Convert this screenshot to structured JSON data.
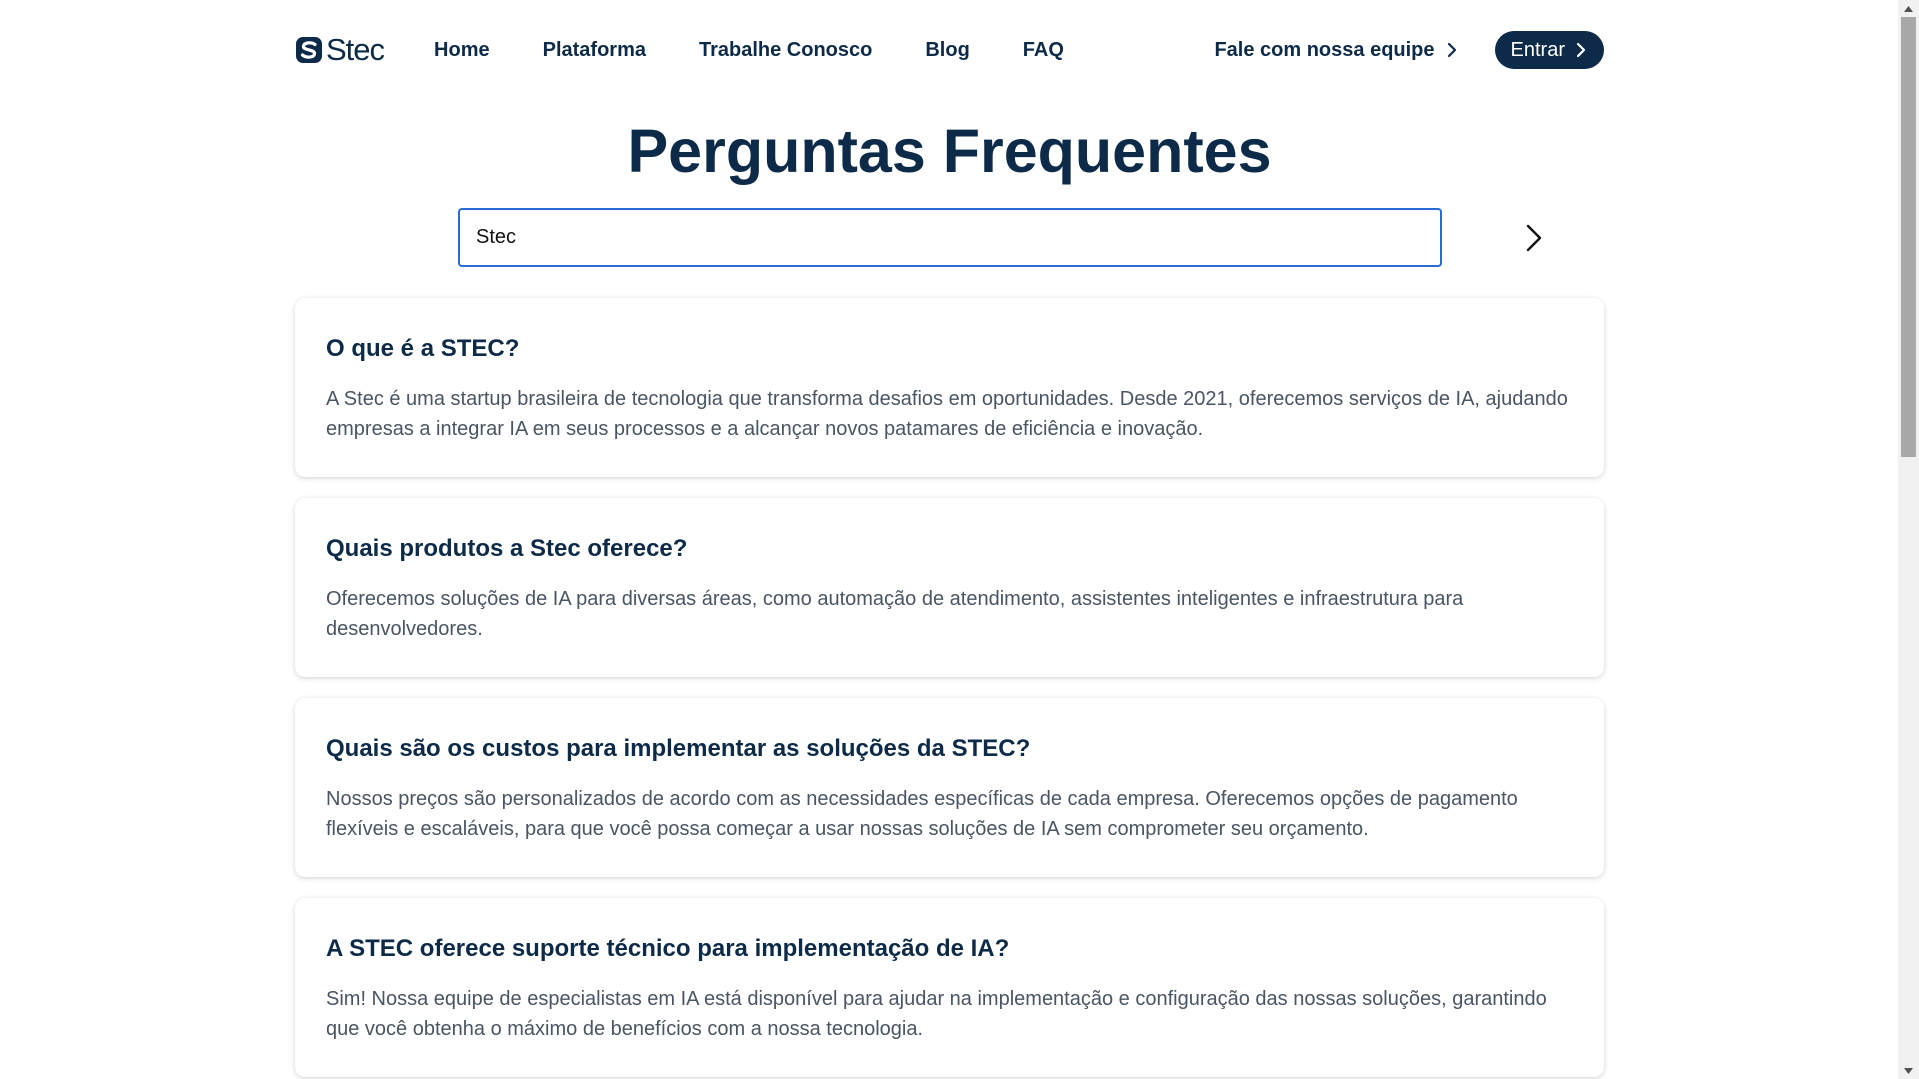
{
  "brand": {
    "name": "Stec"
  },
  "nav": {
    "links": [
      {
        "label": "Home"
      },
      {
        "label": "Plataforma"
      },
      {
        "label": "Trabalhe Conosco"
      },
      {
        "label": "Blog"
      },
      {
        "label": "FAQ"
      }
    ],
    "contact_label": "Fale com nossa equipe",
    "login_label": "Entrar"
  },
  "page": {
    "title": "Perguntas Frequentes"
  },
  "search": {
    "value": "Stec",
    "placeholder": ""
  },
  "faq": {
    "items": [
      {
        "question": "O que é a STEC?",
        "answer": "A Stec é uma startup brasileira de tecnologia que transforma desafios em oportunidades. Desde 2021, oferecemos serviços de IA, ajudando empresas a integrar IA em seus processos e a alcançar novos patamares de eficiência e inovação."
      },
      {
        "question": "Quais produtos a Stec oferece?",
        "answer": "Oferecemos soluções de IA para diversas áreas, como automação de atendimento, assistentes inteligentes e infraestrutura para desenvolvedores."
      },
      {
        "question": "Quais são os custos para implementar as soluções da STEC?",
        "answer": "Nossos preços são personalizados de acordo com as necessidades específicas de cada empresa. Oferecemos opções de pagamento flexíveis e escaláveis, para que você possa começar a usar nossas soluções de IA sem comprometer seu orçamento."
      },
      {
        "question": "A STEC oferece suporte técnico para implementação de IA?",
        "answer": "Sim! Nossa equipe de especialistas em IA está disponível para ajudar na implementação e configuração das nossas soluções, garantindo que você obtenha o máximo de benefícios com a nossa tecnologia."
      }
    ]
  },
  "colors": {
    "brand_navy": "#0d2b49",
    "search_border": "#2a6bd6",
    "answer_text": "#4a5563"
  },
  "icons": {
    "logo": "stec-logo-icon",
    "contact_arrow": "chevron-right-icon",
    "login_arrow": "chevron-right-icon",
    "search_submit": "chevron-right-icon"
  }
}
